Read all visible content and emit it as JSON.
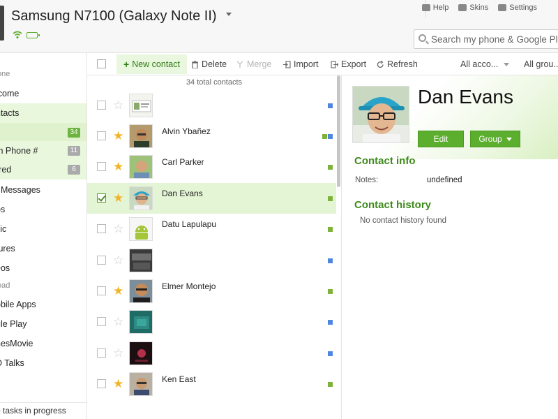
{
  "header": {
    "device_title": "Samsung N7100 (Galaxy Note II)",
    "links": [
      {
        "label": "Help",
        "icon": "chat-bubble-icon"
      },
      {
        "label": "Skins",
        "icon": "skins-shirt-icon"
      },
      {
        "label": "Settings",
        "icon": "wrench-icon"
      }
    ],
    "search_placeholder": "Search my phone & Google Play"
  },
  "sidebar": {
    "sections": [
      "one",
      "oad"
    ],
    "items": [
      {
        "label": "lcome"
      },
      {
        "label": "ntacts"
      },
      {
        "label": "",
        "badge": "34"
      },
      {
        "label": "th Phone #",
        "badge": "11"
      },
      {
        "label": "rred",
        "badge": "6"
      },
      {
        "label": "t Messages"
      },
      {
        "label": "ps"
      },
      {
        "label": "sic"
      },
      {
        "label": "tures"
      },
      {
        "label": "eos"
      },
      {
        "label": "obile Apps"
      },
      {
        "label": "gle Play"
      },
      {
        "label": "nesMovie"
      },
      {
        "label": "D Talks"
      }
    ],
    "footer": "o tasks in progress"
  },
  "toolbar": {
    "new_contact": "New contact",
    "delete": "Delete",
    "merge": "Merge",
    "import": "Import",
    "export": "Export",
    "refresh": "Refresh",
    "accounts_filter": "All acco...",
    "groups_filter": "All grou..."
  },
  "list": {
    "total": "34 total contacts",
    "contacts": [
      {
        "name": "",
        "starred": false,
        "checked": false,
        "accounts": [
          "blue"
        ]
      },
      {
        "name": "Alvin Ybañez",
        "starred": true,
        "checked": false,
        "accounts": [
          "green",
          "blue"
        ]
      },
      {
        "name": "Carl Parker",
        "starred": true,
        "checked": false,
        "accounts": [
          "green"
        ]
      },
      {
        "name": "Dan Evans",
        "starred": true,
        "checked": true,
        "accounts": [
          "green"
        ]
      },
      {
        "name": "Datu Lapulapu",
        "starred": false,
        "checked": false,
        "accounts": [
          "green"
        ]
      },
      {
        "name": "",
        "starred": false,
        "checked": false,
        "accounts": [
          "blue"
        ]
      },
      {
        "name": "Elmer Montejo",
        "starred": true,
        "checked": false,
        "accounts": [
          "green"
        ]
      },
      {
        "name": "",
        "starred": false,
        "checked": false,
        "accounts": [
          "blue"
        ]
      },
      {
        "name": "",
        "starred": false,
        "checked": false,
        "accounts": [
          "blue"
        ]
      },
      {
        "name": "Ken East",
        "starred": true,
        "checked": false,
        "accounts": [
          "green"
        ]
      }
    ]
  },
  "detail": {
    "name": "Dan Evans",
    "edit_label": "Edit",
    "group_label": "Group",
    "contact_info_title": "Contact info",
    "notes_label": "Notes:",
    "notes_value": "undefined",
    "history_title": "Contact history",
    "history_empty": "No contact history found"
  },
  "colors": {
    "accent_green": "#5cae2e",
    "heading_green": "#3f8a1c",
    "selection_bg": "#e4f5d5",
    "account_green": "#7fb23a",
    "account_blue": "#4f86e0",
    "star_gold": "#f0b429"
  }
}
